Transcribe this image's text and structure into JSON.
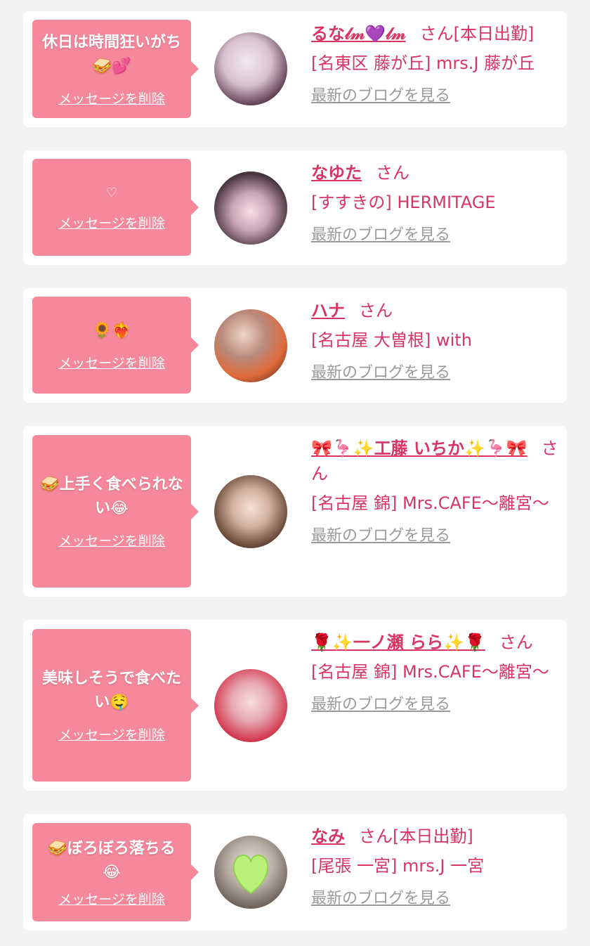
{
  "colors": {
    "page_bg": "#f3f3f3",
    "card_bg": "#ffffff",
    "bubble_bg": "#f5889a",
    "accent_text": "#d83563",
    "muted_link": "#9a9a9a"
  },
  "delete_label": "メッセージを削除",
  "blog_label": "最新のブログを見る",
  "items": [
    {
      "message": "休日は時間狂いがち🥪💕",
      "name": "るな𝓁𝓂💜𝓁𝓂",
      "san": "さん[本日出勤]",
      "shop": "[名東区 藤が丘] mrs.J 藤が丘"
    },
    {
      "message": "♡",
      "name": "なゆた",
      "san": "さん",
      "shop": "[すすきの] HERMITAGE"
    },
    {
      "message": "🌻❤️‍🔥",
      "name": "ハナ",
      "san": "さん",
      "shop": "[名古屋 大曽根] with"
    },
    {
      "message": "🥪上手く食べられない😂",
      "name": "🎀🦩✨工藤 いちか✨🦩🎀",
      "san": "さん",
      "shop": "[名古屋 錦] Mrs.CAFE〜離宮〜"
    },
    {
      "message": "美味しそうで食べたい🤤",
      "name": "🌹✨一ノ瀬 らら✨🌹",
      "san": "さん",
      "shop": "[名古屋 錦] Mrs.CAFE〜離宮〜"
    },
    {
      "message": "🥪ぼろぼろ落ちる😂",
      "name": "なみ",
      "san": "さん[本日出勤]",
      "shop": "[尾張 一宮] mrs.J 一宮"
    }
  ]
}
